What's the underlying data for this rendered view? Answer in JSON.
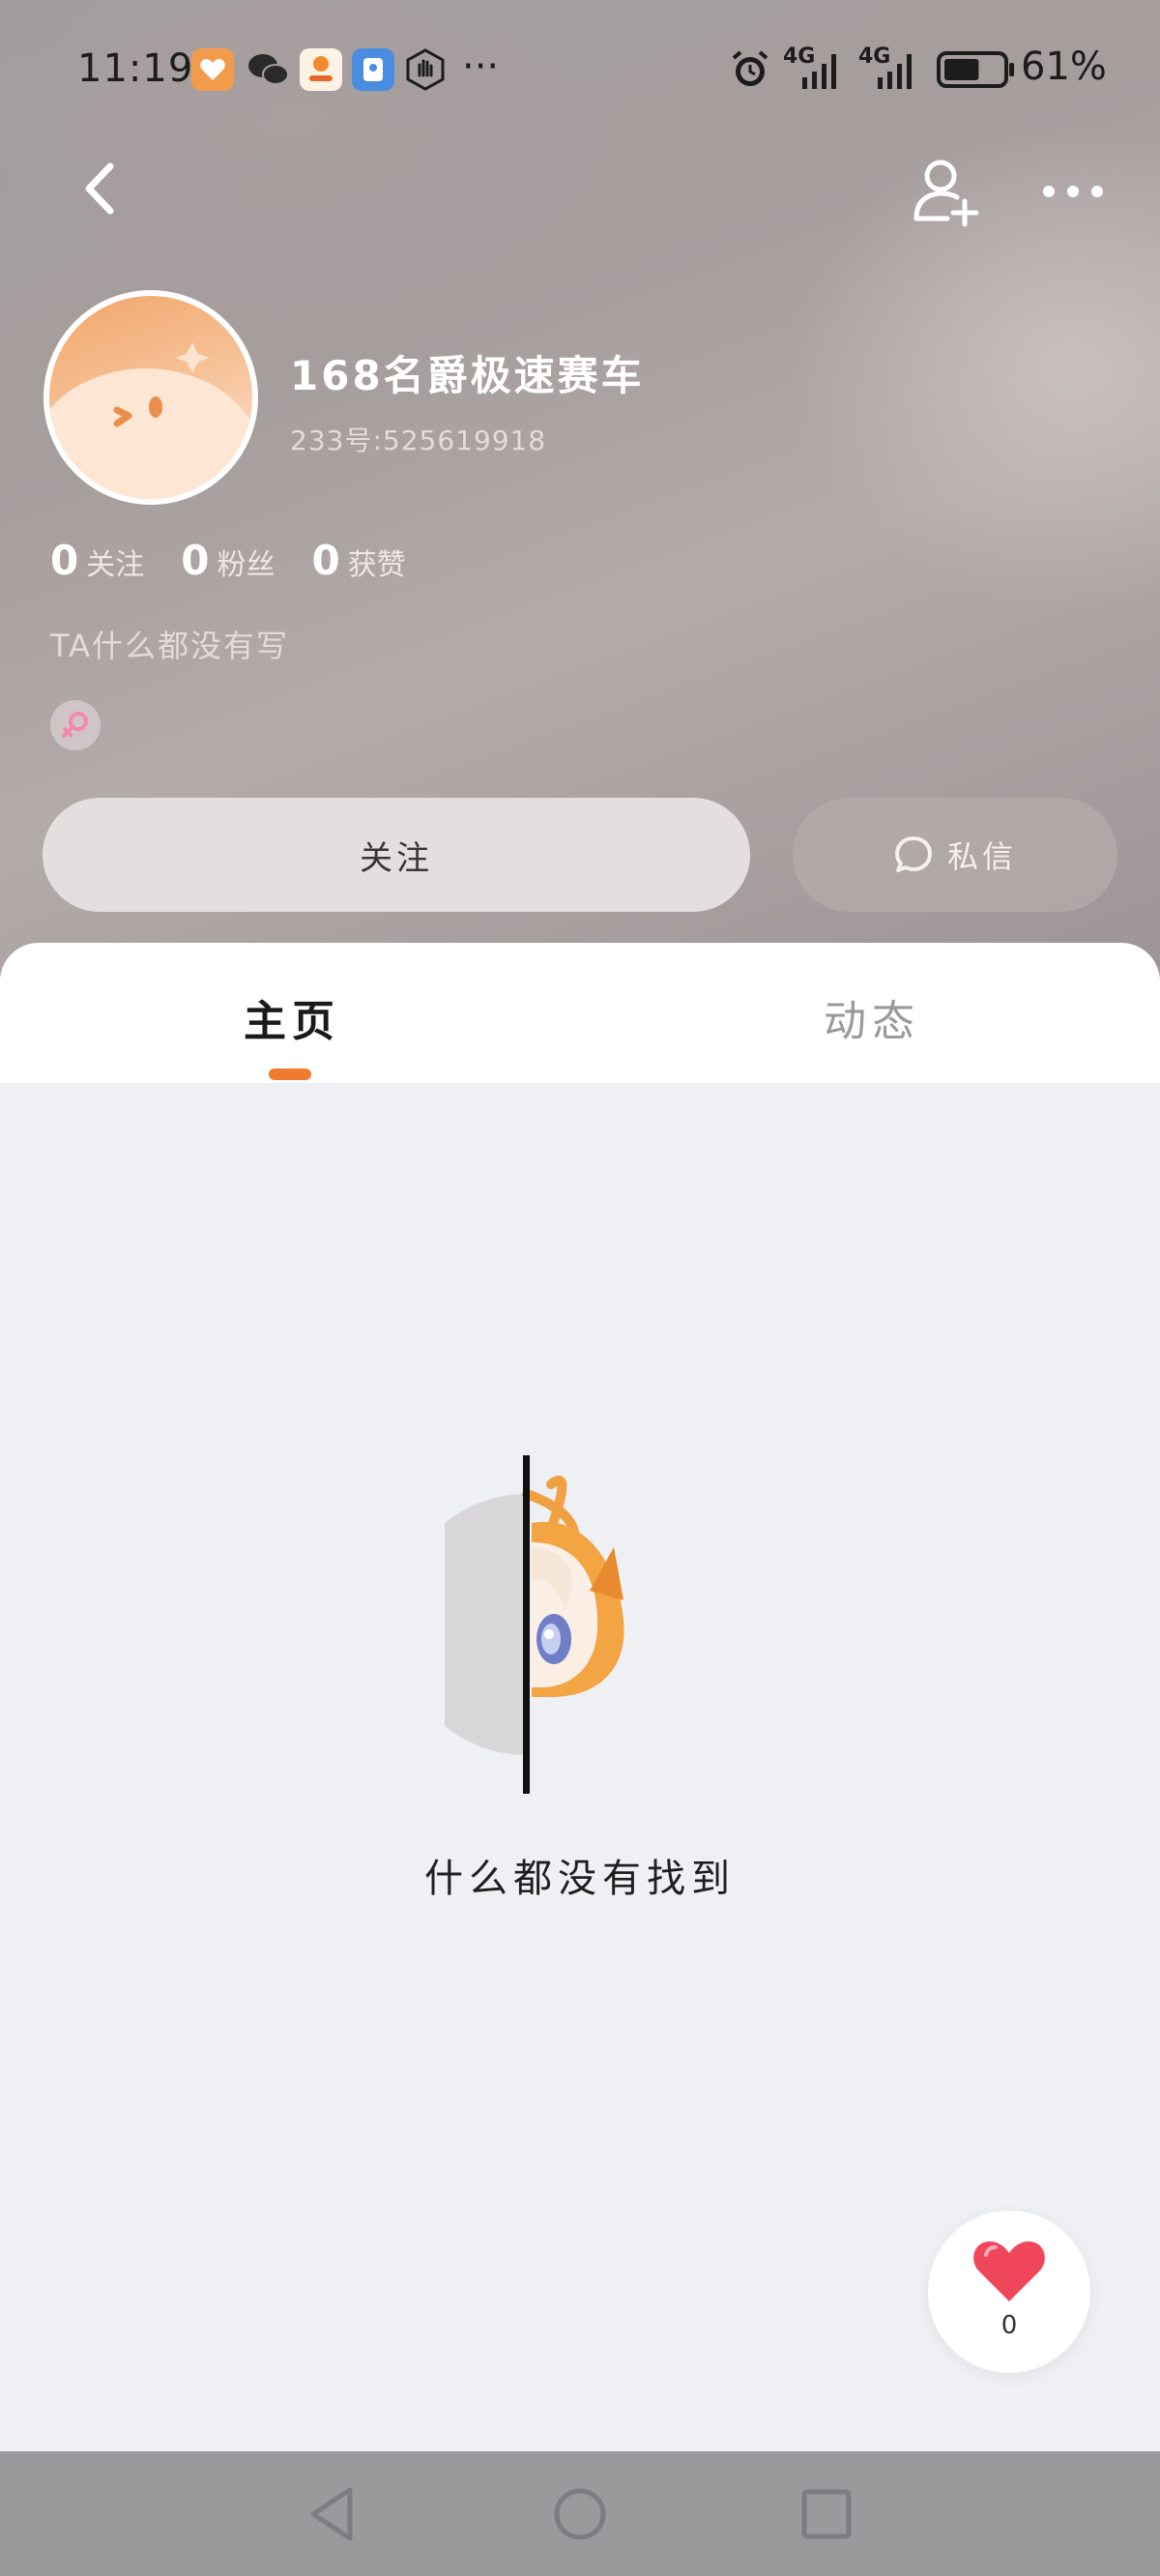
{
  "status_bar": {
    "time": "11:19",
    "more_indicator": "···",
    "network_1": "4G",
    "network_2": "4G",
    "battery_percent": "61%",
    "battery_level": 0.61,
    "icons": [
      "app-notification-icon",
      "wechat-icon",
      "app-icon",
      "app-icon",
      "gesture-icon",
      "alarm-icon",
      "signal-icon",
      "signal-icon",
      "battery-icon"
    ]
  },
  "header": {
    "back_icon": "chevron-left-icon",
    "add_friend_icon": "add-user-icon",
    "more_icon": "more-horizontal-icon"
  },
  "profile": {
    "username": "168名爵极速赛车",
    "user_id": "233号:525619918",
    "stats": [
      {
        "value": "0",
        "label": "关注"
      },
      {
        "value": "0",
        "label": "粉丝"
      },
      {
        "value": "0",
        "label": "获赞"
      }
    ],
    "bio": "TA什么都没有写",
    "gender_icon": "female-icon"
  },
  "actions": {
    "follow_label": "关注",
    "message_label": "私信",
    "message_icon": "chat-bubble-icon"
  },
  "tabs": [
    {
      "label": "主页",
      "active": true
    },
    {
      "label": "动态",
      "active": false
    }
  ],
  "empty_state": {
    "text": "什么都没有找到",
    "illustration": "peeking-character-illustration"
  },
  "like_fab": {
    "count": "0",
    "icon": "heart-icon"
  },
  "nav_bar": {
    "icons": [
      "back-triangle-icon",
      "home-circle-icon",
      "recents-square-icon"
    ]
  },
  "colors": {
    "accent": "#f07a30",
    "heart": "#f0475a",
    "avatar": "#f0a66c"
  }
}
